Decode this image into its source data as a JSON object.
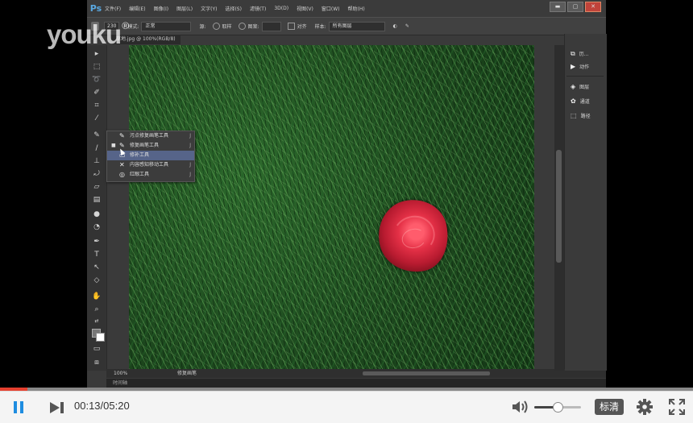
{
  "watermark": {
    "brand": "youku",
    "sup": "®"
  },
  "photoshop": {
    "app_logo": "Ps",
    "menu": [
      "文件(F)",
      "编辑(E)",
      "图像(I)",
      "图层(L)",
      "文字(Y)",
      "选择(S)",
      "滤镜(T)",
      "3D(D)",
      "视图(V)",
      "窗口(W)",
      "帮助(H)"
    ],
    "window_buttons": [
      "▬",
      "▢",
      "✕"
    ],
    "options_bar": {
      "brush_size": "230",
      "mode_label": "模式:",
      "mode_value": "正常",
      "source_label": "源:",
      "sampled_label": "取样",
      "pattern_label": "图案:",
      "aligned_label": "对齐",
      "sample_label": "样本:",
      "sample_value": "所有图层"
    },
    "document_tab": "草地.jpg @ 100%(RGB/8)",
    "flyout": [
      {
        "label": "污点修复画笔工具",
        "icon": "✎",
        "active": false
      },
      {
        "label": "修复画笔工具",
        "icon": "✎",
        "active": true
      },
      {
        "label": "修补工具",
        "icon": "▭",
        "active": false
      },
      {
        "label": "内容感知移动工具",
        "icon": "✕",
        "active": false
      },
      {
        "label": "红眼工具",
        "icon": "◎",
        "active": false
      }
    ],
    "status": {
      "zoom": "100%",
      "doc_info": "修复画笔"
    },
    "timeline_label": "时间轴",
    "panels": [
      {
        "label": "历...",
        "icon": "⧉"
      },
      {
        "label": "动作",
        "icon": "▶"
      },
      {
        "label": "图层",
        "icon": "◈"
      },
      {
        "label": "通道",
        "icon": "✿"
      },
      {
        "label": "路径",
        "icon": "⬚"
      }
    ]
  },
  "player": {
    "current_time": "00:13",
    "duration": "05:20",
    "time_display": "00:13/05:20",
    "progress": 0.04,
    "volume": 0.5,
    "quality": "标清",
    "colors": {
      "accent": "#1f8de0",
      "progress": "#e5402f"
    }
  }
}
